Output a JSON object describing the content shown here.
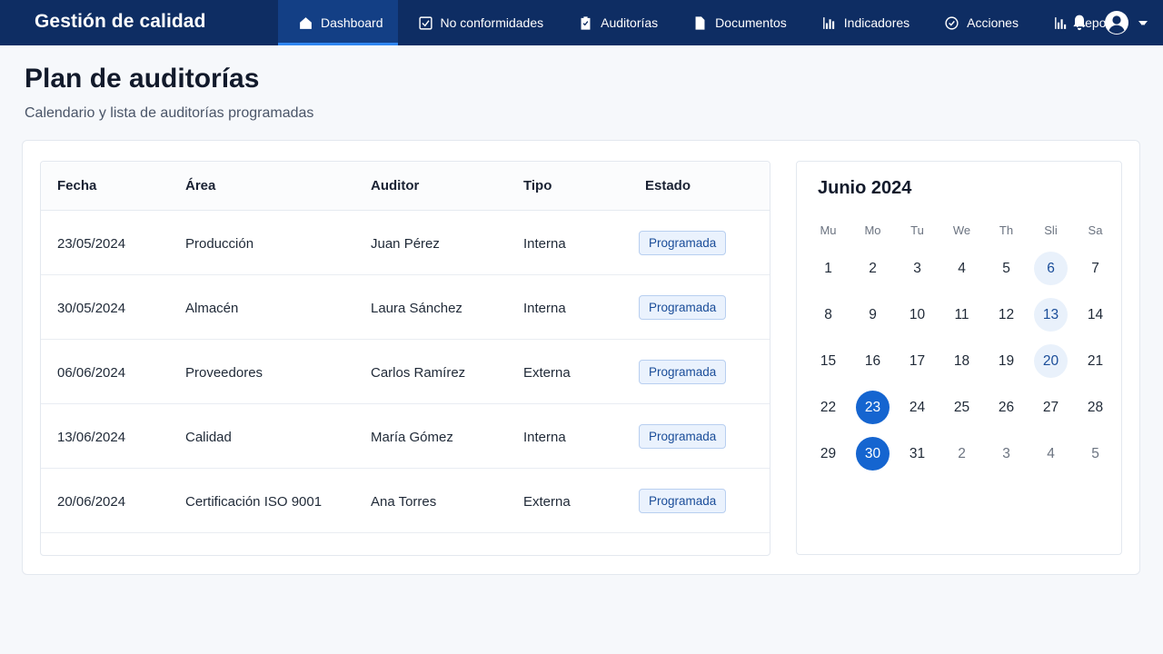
{
  "app": {
    "title": "Gestión de calidad"
  },
  "nav": [
    {
      "label": "Dashboard",
      "icon": "home-icon",
      "active": true
    },
    {
      "label": "No conformidades",
      "icon": "checkbox-icon"
    },
    {
      "label": "Auditorías",
      "icon": "clipboard-check-icon"
    },
    {
      "label": "Documentos",
      "icon": "document-icon"
    },
    {
      "label": "Indicadores",
      "icon": "bar-chart-icon"
    },
    {
      "label": "Acciones",
      "icon": "check-circle-icon"
    },
    {
      "label": "Reportes",
      "icon": "report-chart-icon",
      "dropdown": true
    }
  ],
  "header_icons": {
    "notifications": "bell-icon",
    "account": "user-avatar-icon"
  },
  "page": {
    "title": "Plan de auditorías",
    "subtitle": "Calendario y lista de auditorías programadas"
  },
  "table": {
    "columns": [
      "Fecha",
      "Área",
      "Auditor",
      "Tipo",
      "Estado"
    ],
    "rows": [
      {
        "fecha": "23/05/2024",
        "area": "Producción",
        "auditor": "Juan Pérez",
        "tipo": "Interna",
        "estado": "Programada"
      },
      {
        "fecha": "30/05/2024",
        "area": "Almacén",
        "auditor": "Laura Sánchez",
        "tipo": "Interna",
        "estado": "Programada"
      },
      {
        "fecha": "06/06/2024",
        "area": "Proveedores",
        "auditor": "Carlos Ramírez",
        "tipo": "Externa",
        "estado": "Programada"
      },
      {
        "fecha": "13/06/2024",
        "area": "Calidad",
        "auditor": "María Gómez",
        "tipo": "Interna",
        "estado": "Programada"
      },
      {
        "fecha": "20/06/2024",
        "area": "Certificación ISO 9001",
        "auditor": "Ana Torres",
        "tipo": "Externa",
        "estado": "Programada"
      }
    ]
  },
  "calendar": {
    "title": "Junio 2024",
    "weekdays": [
      "Mu",
      "Mo",
      "Tu",
      "We",
      "Th",
      "Sli",
      "Sa"
    ],
    "days": [
      {
        "d": "1"
      },
      {
        "d": "2"
      },
      {
        "d": "3"
      },
      {
        "d": "4"
      },
      {
        "d": "5"
      },
      {
        "d": "6",
        "state": "event"
      },
      {
        "d": "7"
      },
      {
        "d": "8"
      },
      {
        "d": "9"
      },
      {
        "d": "10"
      },
      {
        "d": "11"
      },
      {
        "d": "12"
      },
      {
        "d": "13",
        "state": "event"
      },
      {
        "d": "14"
      },
      {
        "d": "15"
      },
      {
        "d": "16"
      },
      {
        "d": "17"
      },
      {
        "d": "18"
      },
      {
        "d": "19"
      },
      {
        "d": "20",
        "state": "event"
      },
      {
        "d": "21"
      },
      {
        "d": "22"
      },
      {
        "d": "23",
        "state": "selected"
      },
      {
        "d": "24"
      },
      {
        "d": "25"
      },
      {
        "d": "26"
      },
      {
        "d": "27"
      },
      {
        "d": "28"
      },
      {
        "d": "29"
      },
      {
        "d": "30",
        "state": "selected"
      },
      {
        "d": "31"
      },
      {
        "d": "2",
        "state": "muted"
      },
      {
        "d": "3",
        "state": "muted"
      },
      {
        "d": "4",
        "state": "muted"
      },
      {
        "d": "5",
        "state": "muted"
      }
    ]
  },
  "colors": {
    "topbar": "#0e2d63",
    "accent": "#1565d0",
    "badge_text": "#1a4d99"
  }
}
